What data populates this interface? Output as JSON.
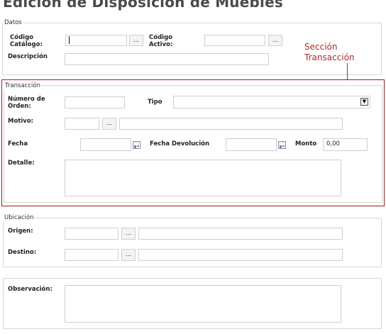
{
  "page": {
    "title": "Edición de Disposición de Muebles"
  },
  "annotation": {
    "line1": "Sección",
    "line2": "Transacción",
    "color": "#b02a2a"
  },
  "datos": {
    "legend": "Datos",
    "codigo_catalogo_label1": "Código",
    "codigo_catalogo_label2": "Catálogo:",
    "codigo_catalogo_value": "",
    "codigo_activo_label1": "Código",
    "codigo_activo_label2": "Activo:",
    "codigo_activo_value": "",
    "descripcion_label": "Descripción",
    "descripcion_value": "",
    "lookup_label": "..."
  },
  "transaccion": {
    "legend": "Transacción",
    "numero_orden_label1": "Número de",
    "numero_orden_label2": "Orden:",
    "numero_orden_value": "",
    "tipo_label": "Tipo",
    "tipo_value": "",
    "motivo_label": "Motivo:",
    "motivo_code": "",
    "motivo_desc": "",
    "fecha_label": "Fecha",
    "fecha_value": "",
    "fecha_devolucion_label": "Fecha Devolución",
    "fecha_devolucion_value": "",
    "monto_label": "Monto",
    "monto_value": "0,00",
    "detalle_label": "Detalle:",
    "detalle_value": "",
    "lookup_label": "...",
    "select_arrow": "▼"
  },
  "ubicacion": {
    "legend": "Ubicación",
    "origen_label": "Origen:",
    "origen_code": "",
    "origen_desc": "",
    "destino_label": "Destino:",
    "destino_code": "",
    "destino_desc": "",
    "lookup_label": "..."
  },
  "observacion": {
    "label": "Observación:",
    "value": ""
  }
}
